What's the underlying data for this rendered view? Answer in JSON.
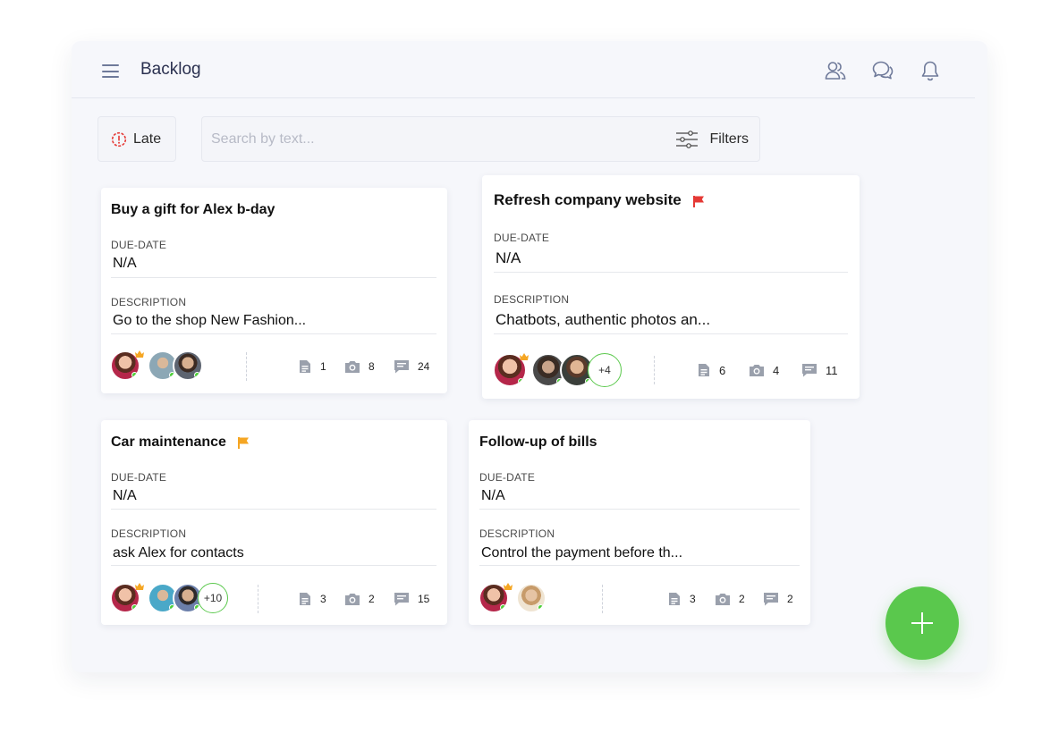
{
  "header": {
    "title": "Backlog",
    "icons": [
      "menu-icon",
      "users-icon",
      "chat-icon",
      "bell-icon"
    ]
  },
  "toolbar": {
    "late_label": "Late",
    "search_placeholder": "Search by text...",
    "filters_label": "Filters"
  },
  "labels": {
    "due_date": "DUE-DATE",
    "description": "DESCRIPTION"
  },
  "colors": {
    "accent_green": "#5ac84d",
    "flag_red": "#e53935",
    "flag_orange": "#f5a623",
    "late_red": "#e53935"
  },
  "cards": [
    {
      "title": "Buy a gift for Alex b-day",
      "flag": null,
      "due_date": "N/A",
      "description": "Go to the shop New Fashion...",
      "extra_members": null,
      "files": "1",
      "photos": "8",
      "comments": "24"
    },
    {
      "title": "Refresh company website",
      "flag": "red",
      "due_date": "N/A",
      "description": "Chatbots, authentic photos an...",
      "extra_members": "+4",
      "files": "6",
      "photos": "4",
      "comments": "11"
    },
    {
      "title": "Car maintenance",
      "flag": "orange",
      "due_date": "N/A",
      "description": "ask Alex for contacts",
      "extra_members": "+10",
      "files": "3",
      "photos": "2",
      "comments": "15"
    },
    {
      "title": "Follow-up of bills",
      "flag": null,
      "due_date": "N/A",
      "description": "Control the payment before th...",
      "extra_members": null,
      "files": "3",
      "photos": "2",
      "comments": "2"
    }
  ]
}
